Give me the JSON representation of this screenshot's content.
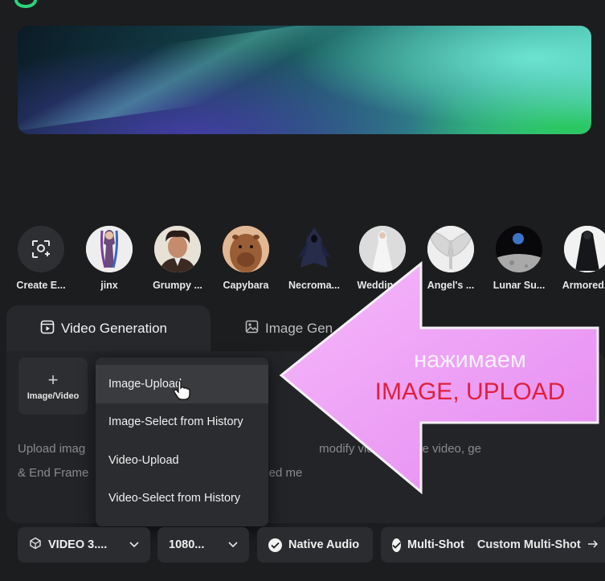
{
  "effects": [
    {
      "label": "Create E...",
      "icon": "create-effect-icon"
    },
    {
      "label": "jinx"
    },
    {
      "label": "Grumpy ..."
    },
    {
      "label": "Capybara"
    },
    {
      "label": "Necroma..."
    },
    {
      "label": "Wedding..."
    },
    {
      "label": "Angel's ..."
    },
    {
      "label": "Lunar Su..."
    },
    {
      "label": "Armored..."
    }
  ],
  "tabs": {
    "video": "Video Generation",
    "image": "Image Gen"
  },
  "upload_tile": {
    "plus": "+",
    "label": "Image/Video"
  },
  "description": {
    "line1": "Upload imag                              enerate with re                modify video, restyle video, ge",
    "line2": "& End Frame                               erence uploaded me"
  },
  "dropdown": {
    "items": [
      "Image-Upload",
      "Image-Select from History",
      "Video-Upload",
      "Video-Select from History"
    ]
  },
  "annotation": {
    "line1": "нажимаем",
    "line2": "IMAGE, UPLOAD",
    "arrow_color": "#ee9bf5",
    "text_color": "#e0203a"
  },
  "bottom": {
    "model": "VIDEO 3....",
    "resolution": "1080...",
    "native_audio": "Native Audio",
    "multishot": "Multi-Shot",
    "custom_multishot": "Custom Multi-Shot"
  }
}
